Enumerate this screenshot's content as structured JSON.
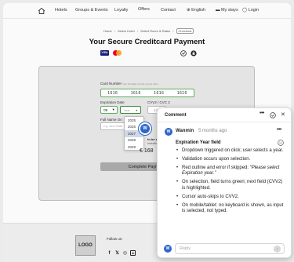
{
  "nav": {
    "items": [
      "Hotels",
      "Groups & Events",
      "Loyalty",
      "Offers",
      "Contact",
      "English",
      "My stays",
      "Login"
    ]
  },
  "breadcrumb": [
    "Home",
    "Select Hotel",
    "Select Room & Rates",
    "Checkout"
  ],
  "page_title": "Your Secure Creditcard Payment",
  "cards": {
    "visa": "VISA"
  },
  "form": {
    "card_number_label": "Card Number",
    "card_number_hint": "Your 16-digits in front of your card",
    "card_number_groups": [
      "1616",
      "1616",
      "1616",
      "1616"
    ],
    "expiration_label": "Expiration Date",
    "month_value": "09",
    "year_placeholder": "Year",
    "cvv_label": "CVV2 / CVC 2",
    "cvv_value": "123",
    "cvv_hint": "The last 3 digits on the back",
    "full_name_label": "Full Name On",
    "full_name_placeholder": "e.g. John Smith",
    "year_options": [
      "2025",
      "2026",
      "2027",
      "2028",
      "2029",
      "2030"
    ],
    "pay_text": "to be charged",
    "pay_text2": "Including tax",
    "price": "€ 168",
    "pay_button": "Complete Payment"
  },
  "pin": {
    "initial": "W"
  },
  "footer": {
    "logo": "LOGO",
    "follow": "Follow us:"
  },
  "comment": {
    "header": "Comment",
    "avatar": "W",
    "author": "Wanmin",
    "time": "5 months ago",
    "title": "Expiration Year field",
    "bullets": [
      "Dropdown triggered on click; user selects a year.",
      "Validation occurs upon selection.",
      "Red outline and error if skipped: ",
      "On selection, field turns green; next field (CVV2) is highlighted.",
      "Cursor auto-skips to CVV2.",
      "On mobile/tablet: no keyboard is shown, as input is selected, not typed."
    ],
    "error_quote": "“Please select Expiration year.”",
    "reply_placeholder": "Reply",
    "reply_avatar": "W"
  }
}
